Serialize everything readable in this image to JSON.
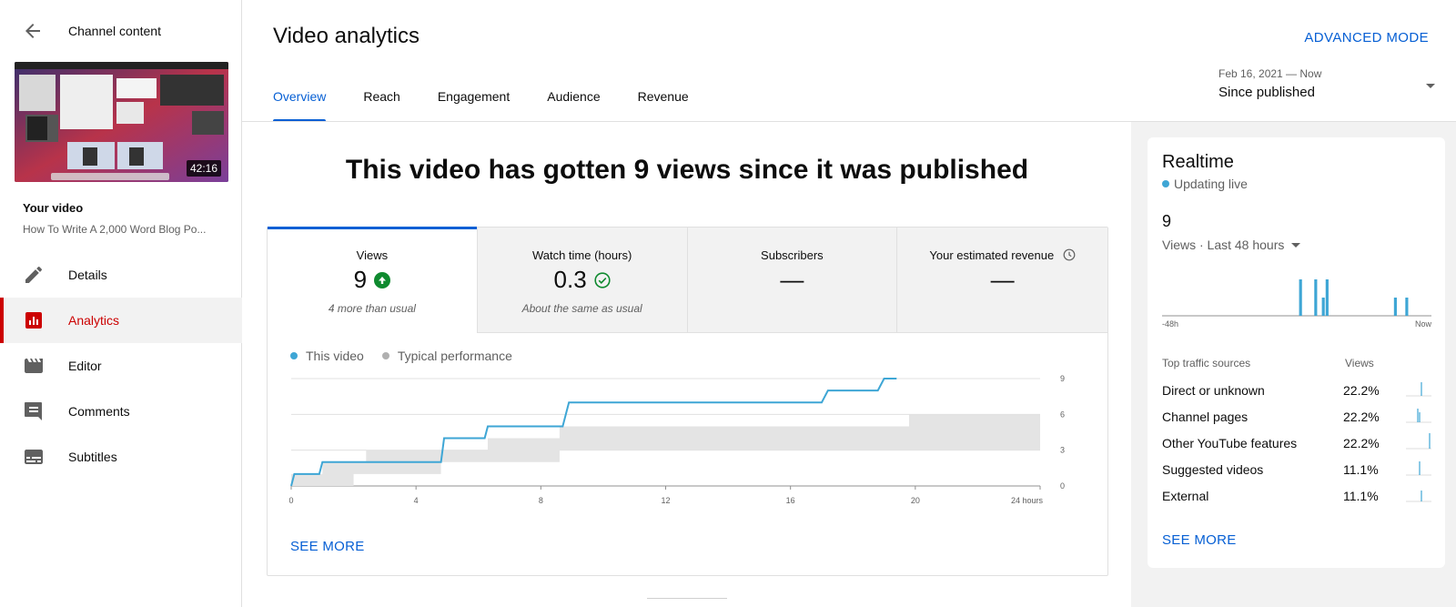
{
  "sidebar": {
    "back_title": "Channel content",
    "thumbnail_duration": "42:16",
    "your_video_label": "Your video",
    "video_title": "How To Write A 2,000 Word Blog Po...",
    "items": [
      {
        "label": "Details",
        "icon": "pencil-icon"
      },
      {
        "label": "Analytics",
        "icon": "analytics-icon",
        "active": true
      },
      {
        "label": "Editor",
        "icon": "clapperboard-icon"
      },
      {
        "label": "Comments",
        "icon": "comment-icon"
      },
      {
        "label": "Subtitles",
        "icon": "subtitles-icon"
      }
    ]
  },
  "header": {
    "title": "Video analytics",
    "advanced_mode": "ADVANCED MODE",
    "tabs": [
      "Overview",
      "Reach",
      "Engagement",
      "Audience",
      "Revenue"
    ],
    "date_range": "Feb 16, 2021 — Now",
    "date_label": "Since published"
  },
  "main": {
    "headline": "This video has gotten 9 views since it was published",
    "metrics": [
      {
        "label": "Views",
        "value": "9",
        "note": "4 more than usual",
        "status": "up"
      },
      {
        "label": "Watch time (hours)",
        "value": "0.3",
        "note": "About the same as usual",
        "status": "same"
      },
      {
        "label": "Subscribers",
        "value": "—",
        "note": ""
      },
      {
        "label": "Your estimated revenue",
        "value": "—",
        "note": ""
      }
    ],
    "legend": {
      "this_video": "This video",
      "typical": "Typical performance"
    },
    "see_more": "SEE MORE"
  },
  "chart_data": {
    "type": "line",
    "x_ticks": [
      "0",
      "4",
      "8",
      "12",
      "16",
      "20",
      "24 hours"
    ],
    "y_ticks": [
      "0",
      "3",
      "6",
      "9"
    ],
    "xlim": [
      0,
      24
    ],
    "ylim": [
      0,
      9
    ],
    "series": [
      {
        "name": "This video",
        "color": "#3ea6d5",
        "x": [
          0,
          0.1,
          0.2,
          0.9,
          1.0,
          4.8,
          4.9,
          6.2,
          6.3,
          8.7,
          8.9,
          17.0,
          17.2,
          18.8,
          19.0,
          19.4
        ],
        "y": [
          0,
          1,
          1,
          1,
          2,
          2,
          4,
          4,
          5,
          5,
          7,
          7,
          8,
          8,
          9,
          9
        ]
      }
    ],
    "typical_band": {
      "name": "Typical performance",
      "x": [
        0,
        1,
        2,
        2.4,
        4.8,
        6.3,
        8.6,
        8.6,
        19.8,
        24
      ],
      "low": [
        0,
        0,
        1,
        1,
        2,
        2,
        3,
        3,
        3,
        4
      ],
      "high": [
        1,
        2,
        2,
        3,
        3,
        4,
        4,
        5,
        6,
        6
      ]
    },
    "colors": {
      "this_video": "#3ea6d5",
      "typical": "#e4e4e4",
      "grid": "#e0e0e0"
    }
  },
  "realtime": {
    "title": "Realtime",
    "status": "Updating live",
    "count": "9",
    "selector": "Views · Last 48 hours",
    "axis_left": "-48h",
    "axis_right": "Now",
    "bars": [
      0,
      0,
      0,
      0,
      0,
      0,
      0,
      0,
      0,
      0,
      0,
      0,
      0,
      0,
      0,
      0,
      0,
      0,
      0,
      0,
      0,
      0,
      0,
      0,
      0,
      0,
      0,
      0,
      0,
      0,
      0,
      0,
      0,
      0,
      0,
      0,
      2,
      0,
      0,
      0,
      2,
      0,
      1,
      2,
      0,
      0,
      0,
      0,
      0,
      0,
      0,
      0,
      0,
      0,
      0,
      0,
      0,
      0,
      0,
      0,
      0,
      1,
      0,
      0,
      1,
      0,
      0,
      0,
      0,
      0,
      0
    ],
    "sources_header": "Top traffic sources",
    "views_header": "Views",
    "sources": [
      {
        "name": "Direct or unknown",
        "pct": "22.2%"
      },
      {
        "name": "Channel pages",
        "pct": "22.2%"
      },
      {
        "name": "Other YouTube features",
        "pct": "22.2%"
      },
      {
        "name": "Suggested videos",
        "pct": "11.1%"
      },
      {
        "name": "External",
        "pct": "11.1%"
      }
    ],
    "see_more": "SEE MORE"
  }
}
